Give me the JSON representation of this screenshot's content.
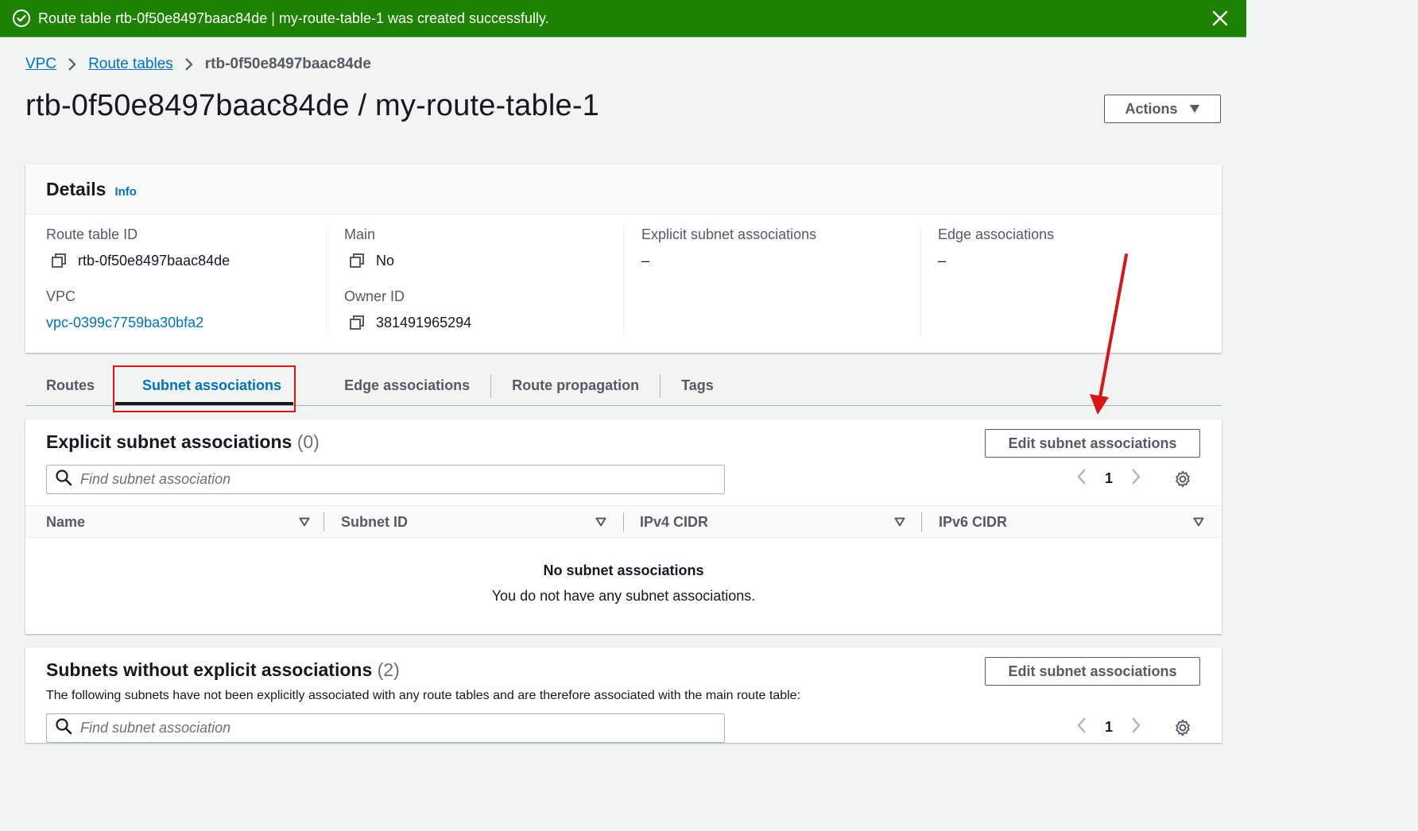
{
  "flash": {
    "message": "Route table rtb-0f50e8497baac84de | my-route-table-1 was created successfully.",
    "icon": "check-circle-icon",
    "color": "#1d8102"
  },
  "breadcrumb": {
    "items": [
      "VPC",
      "Route tables"
    ],
    "current": "rtb-0f50e8497baac84de"
  },
  "page": {
    "title": "rtb-0f50e8497baac84de / my-route-table-1",
    "actions_label": "Actions"
  },
  "details": {
    "title": "Details",
    "info": "Info",
    "route_table_id_label": "Route table ID",
    "route_table_id": "rtb-0f50e8497baac84de",
    "vpc_label": "VPC",
    "vpc": "vpc-0399c7759ba30bfa2",
    "main_label": "Main",
    "main": "No",
    "owner_label": "Owner ID",
    "owner": "381491965294",
    "explicit_label": "Explicit subnet associations",
    "explicit": "–",
    "edge_label": "Edge associations",
    "edge": "–"
  },
  "tabs": [
    "Routes",
    "Subnet associations",
    "Edge associations",
    "Route propagation",
    "Tags"
  ],
  "explicit_section": {
    "title": "Explicit subnet associations",
    "count": "(0)",
    "edit_label": "Edit subnet associations",
    "search_placeholder": "Find subnet association",
    "page": "1",
    "columns": [
      "Name",
      "Subnet ID",
      "IPv4 CIDR",
      "IPv6 CIDR"
    ],
    "empty_title": "No subnet associations",
    "empty_desc": "You do not have any subnet associations."
  },
  "without_section": {
    "title": "Subnets without explicit associations",
    "count": "(2)",
    "edit_label": "Edit subnet associations",
    "description": "The following subnets have not been explicitly associated with any route tables and are therefore associated with the main route table:",
    "search_placeholder": "Find subnet association",
    "page": "1"
  },
  "annotation_color": "#d91515",
  "link_color": "#0073bb"
}
